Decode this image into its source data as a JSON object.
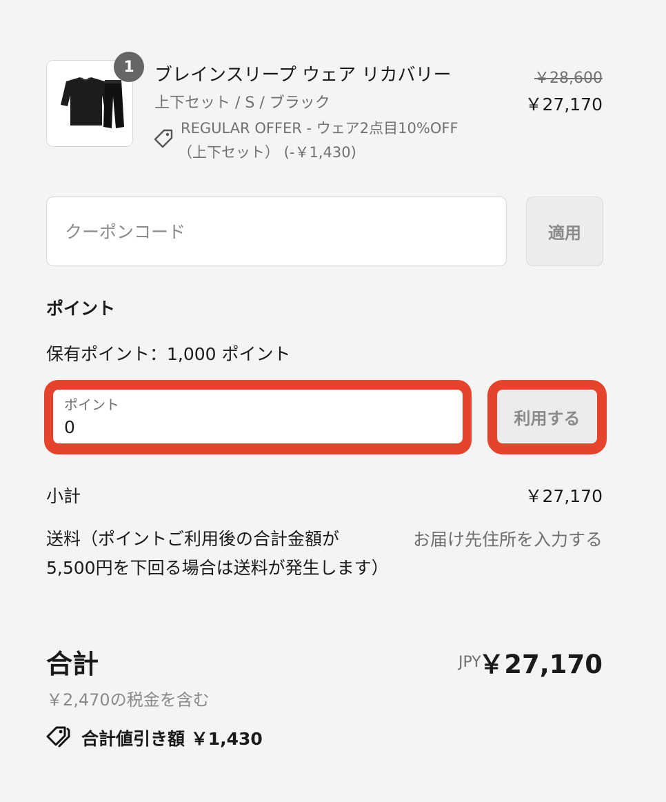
{
  "product": {
    "quantity": "1",
    "title": "ブレインスリープ ウェア リカバリー",
    "variant": "上下セット / S / ブラック",
    "offer_line1": "REGULAR OFFER - ウェア2点目10%OFF",
    "offer_line2": "（上下セット） (-￥1,430)",
    "original_price": "￥28,600",
    "price": "￥27,170"
  },
  "coupon": {
    "placeholder": "クーポンコード",
    "value": "",
    "apply_label": "適用"
  },
  "points": {
    "heading": "ポイント",
    "owned": "保有ポイント：1,000 ポイント",
    "field_label": "ポイント",
    "field_value": "0",
    "use_label": "利用する"
  },
  "summary": {
    "subtotal_label": "小計",
    "subtotal_value": "￥27,170",
    "shipping_label": "送料（ポイントご利用後の合計金額が5,500円を下回る場合は送料が発生します）",
    "shipping_value": "お届け先住所を入力する",
    "total_label": "合計",
    "currency": "JPY",
    "total_value": "￥27,170",
    "tax_note": "￥2,470の税金を含む",
    "discount_label": "合計値引き額 ￥1,430"
  },
  "colors": {
    "highlight": "#e5442c",
    "background": "#f4f4f4"
  },
  "icons": {
    "offer": "tag-icon",
    "discount": "tags-icon",
    "product": "product-thumbnail"
  }
}
